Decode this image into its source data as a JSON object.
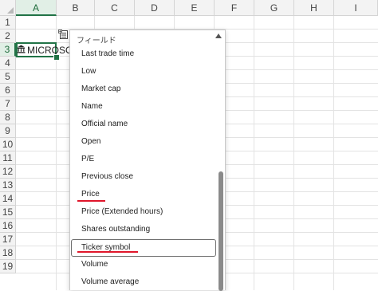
{
  "columns": [
    "A",
    "B",
    "C",
    "D",
    "E",
    "F",
    "G",
    "H",
    "I"
  ],
  "rows": [
    "1",
    "2",
    "3",
    "4",
    "5",
    "6",
    "7",
    "8",
    "9",
    "10",
    "11",
    "12",
    "13",
    "14",
    "15",
    "16",
    "17",
    "18",
    "19"
  ],
  "cell_a3": {
    "icon": "bank-icon",
    "text": "MICROSOFT"
  },
  "field_panel": {
    "header": "フィールド",
    "items": [
      "Last trade time",
      "Low",
      "Market cap",
      "Name",
      "Official name",
      "Open",
      "P/E",
      "Previous close",
      "Price",
      "Price (Extended hours)",
      "Shares outstanding",
      "Ticker symbol",
      "Volume",
      "Volume average"
    ],
    "highlighted_item": "Ticker symbol",
    "underlined_items": [
      "Price",
      "Ticker symbol"
    ]
  },
  "colors": {
    "accent": "#217346",
    "underline": "#e0162b"
  }
}
